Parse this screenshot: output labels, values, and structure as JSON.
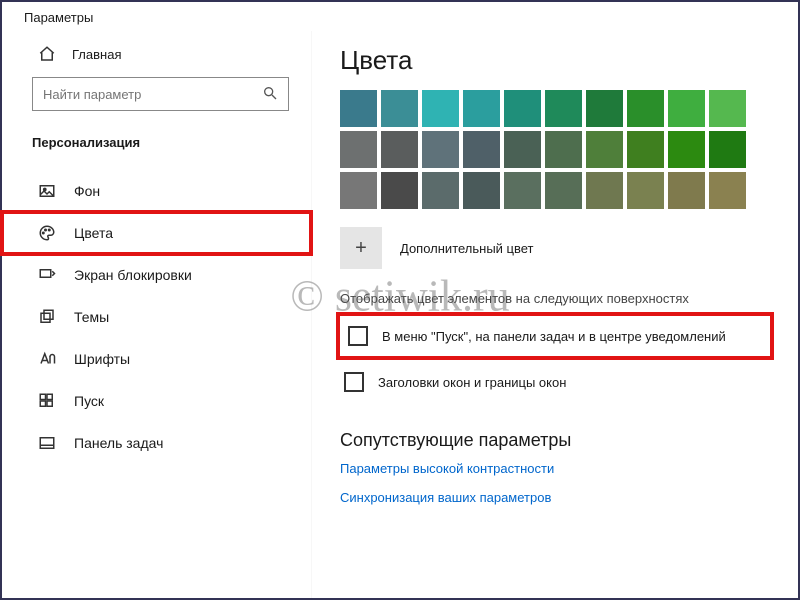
{
  "header": {
    "title": "Параметры"
  },
  "sidebar": {
    "home_label": "Главная",
    "search_placeholder": "Найти параметр",
    "category_label": "Персонализация",
    "items": [
      {
        "label": "Фон"
      },
      {
        "label": "Цвета"
      },
      {
        "label": "Экран блокировки"
      },
      {
        "label": "Темы"
      },
      {
        "label": "Шрифты"
      },
      {
        "label": "Пуск"
      },
      {
        "label": "Панель задач"
      }
    ]
  },
  "main": {
    "title": "Цвета",
    "swatches": [
      [
        "#3a7a8c",
        "#3b8e96",
        "#2fb3b3",
        "#2b9e9e",
        "#1f8f7a",
        "#1f8a5a",
        "#1f7a3a",
        "#2a8f2a",
        "#3fae3f",
        "#55b84f"
      ],
      [
        "#6d7070",
        "#5a5d5d",
        "#5f727a",
        "#4f6068",
        "#4a6155",
        "#4e6e4e",
        "#4f7f3a",
        "#3f7f1f",
        "#2c8a10",
        "#1f7a12"
      ],
      [
        "#777777",
        "#4a4a4a",
        "#5b6b6b",
        "#4a5a5a",
        "#5a6f5f",
        "#576e57",
        "#6f7850",
        "#7a8150",
        "#7f7a4d",
        "#8a8150"
      ]
    ],
    "custom_color_label": "Дополнительный цвет",
    "surfaces_heading": "Отображать цвет элементов на следующих поверхностях",
    "checkbox1_label": "В меню \"Пуск\", на панели задач и в центре уведомлений",
    "checkbox2_label": "Заголовки окон и границы окон",
    "related_title": "Сопутствующие параметры",
    "link1": "Параметры высокой контрастности",
    "link2": "Синхронизация ваших параметров"
  },
  "watermark": "© setiwik.ru"
}
